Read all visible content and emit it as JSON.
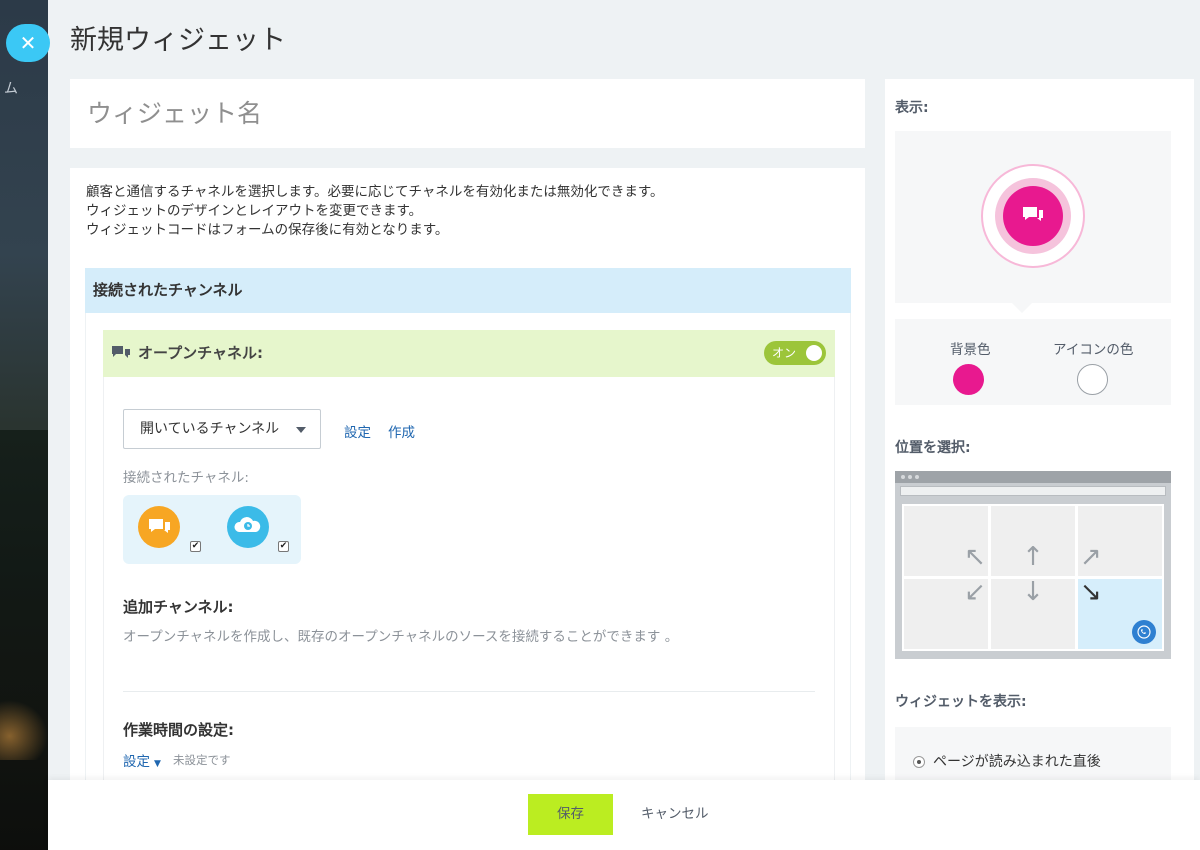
{
  "header": {
    "title": "新規ウィジェット",
    "side_hint": "ム"
  },
  "name_field": {
    "placeholder": "ウィジェット名",
    "value": ""
  },
  "description": [
    "顧客と通信するチャネルを選択します。必要に応じてチャネルを有効化または無効化できます。",
    "ウィジェットのデザインとレイアウトを変更できます。",
    "ウィジェットコードはフォームの保存後に有効となります。"
  ],
  "connected_channels": {
    "heading": "接続されたチャンネル",
    "open_channel": {
      "title": "オープンチャネル:",
      "toggle_label": "オン",
      "toggle_on": true,
      "select_value": "開いているチャンネル",
      "settings_link": "設定",
      "create_link": "作成",
      "connected_label": "接続されたチャネル:",
      "connected_items": [
        {
          "icon": "chat-bubbles-icon",
          "color": "#f7a623",
          "checked": true
        },
        {
          "icon": "cloud-clock-icon",
          "color": "#3bbbe8",
          "checked": true
        }
      ],
      "additional_heading": "追加チャンネル:",
      "additional_text": "オープンチャネルを作成し、既存のオープンチャネルのソースを接続することができます 。",
      "work_hours_heading": "作業時間の設定:",
      "work_hours_link": "設定",
      "work_hours_status": "未設定です"
    }
  },
  "sidebar": {
    "display_label": "表示:",
    "bg_color_label": "背景色",
    "icon_color_label": "アイコンの色",
    "bg_color": "#e8198f",
    "icon_color": "#ffffff",
    "position_label": "位置を選択:",
    "selected_position": "bottom-right",
    "show_label": "ウィジェットを表示:",
    "show_option": "ページが読み込まれた直後"
  },
  "footer": {
    "save_label": "保存",
    "cancel_label": "キャンセル"
  }
}
